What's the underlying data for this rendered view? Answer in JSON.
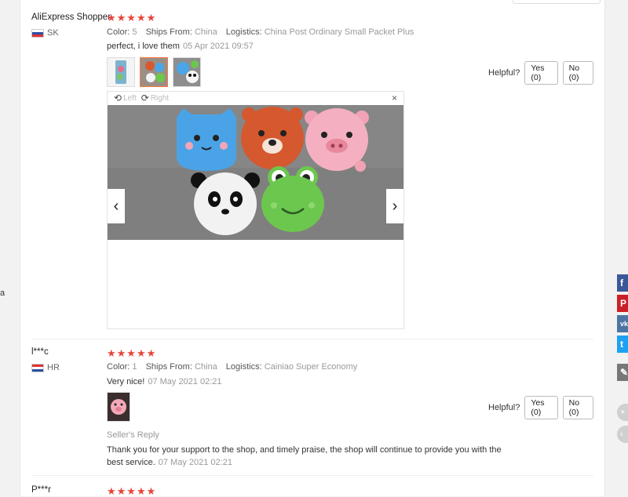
{
  "left_stray": "a",
  "reviews": [
    {
      "name": "AliExpress Shopper",
      "country": "SK",
      "stars": "★★★★★",
      "color_label": "Color:",
      "color_value": "5",
      "ships_label": "Ships From:",
      "ships_value": "China",
      "logistics_label": "Logistics:",
      "logistics_value": "China Post Ordinary Small Packet Plus",
      "text": "perfect, i love them",
      "date": "05 Apr 2021 09:57",
      "helpful_label": "Helpful?",
      "yes_label": "Yes (0)",
      "no_label": "No (0)"
    },
    {
      "name": "l***c",
      "country": "HR",
      "stars": "★★★★★",
      "color_label": "Color:",
      "color_value": "1",
      "ships_label": "Ships From:",
      "ships_value": "China",
      "logistics_label": "Logistics:",
      "logistics_value": "Cainiao Super Economy",
      "text": "Very nice!",
      "date": "07 May 2021 02:21",
      "helpful_label": "Helpful?",
      "yes_label": "Yes (0)",
      "no_label": "No (0)",
      "reply_title": "Seller's Reply",
      "reply_text": "Thank you for your support to the shop, and timely praise, the shop will continue to provide you with the best service.",
      "reply_date": "07 May 2021 02:21"
    },
    {
      "name": "P***r",
      "stars": "★★★★★"
    }
  ],
  "viewer": {
    "left_label": "Left",
    "right_label": "Right",
    "close": "×",
    "prev": "‹",
    "next": "›"
  },
  "share": {
    "facebook": "f",
    "pinterest": "P",
    "vk": "vk",
    "twitter": "t",
    "edit": "✎",
    "close": "×",
    "collapse": "‹"
  },
  "colors": {
    "star": "#e8443a",
    "facebook": "#3b5998",
    "pinterest": "#cb2027",
    "vk": "#4c75a3",
    "twitter": "#1da1f2"
  }
}
